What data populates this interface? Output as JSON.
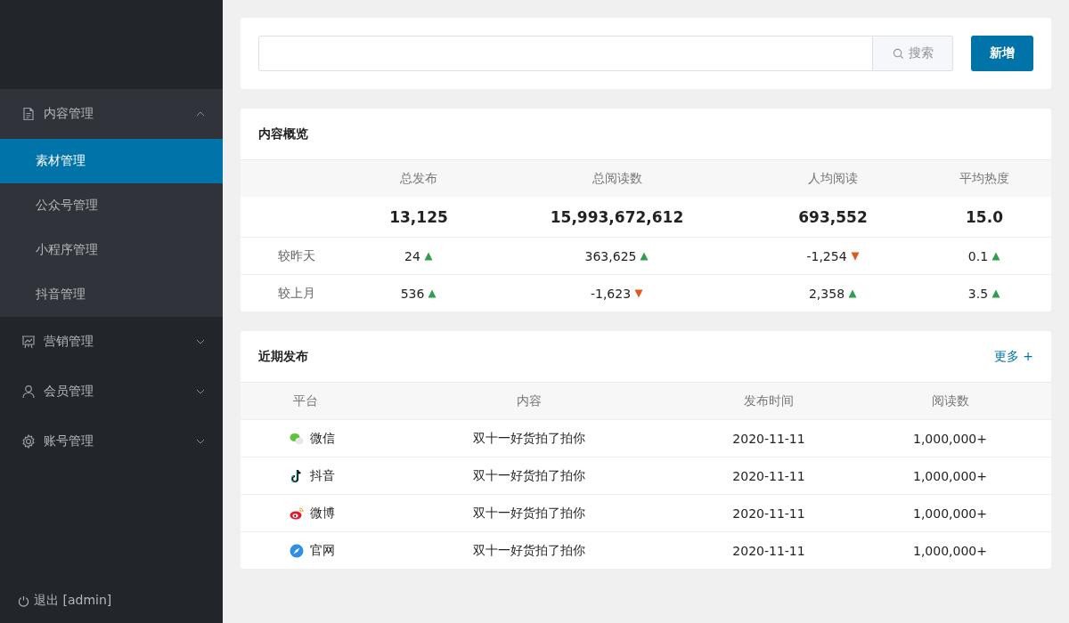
{
  "sidebar": {
    "menus": [
      {
        "kind": "document",
        "label": "内容管理",
        "expanded": true,
        "children": [
          {
            "label": "素材管理",
            "selected": true
          },
          {
            "label": "公众号管理",
            "selected": false
          },
          {
            "label": "小程序管理",
            "selected": false
          },
          {
            "label": "抖音管理",
            "selected": false
          }
        ]
      },
      {
        "kind": "chart",
        "label": "营销管理",
        "expanded": false
      },
      {
        "kind": "user",
        "label": "会员管理",
        "expanded": false
      },
      {
        "kind": "gear",
        "label": "账号管理",
        "expanded": false
      }
    ],
    "logout": "退出 [admin]"
  },
  "search": {
    "button": "搜索"
  },
  "add_button": "新增",
  "overview": {
    "title": "内容概览",
    "columns": [
      "总发布",
      "总阅读数",
      "人均阅读",
      "平均热度"
    ],
    "totals": [
      "13,125",
      "15,993,672,612",
      "693,552",
      "15.0"
    ],
    "rows": [
      {
        "label": "较昨天",
        "cells": [
          {
            "value": "24",
            "kind": "up"
          },
          {
            "value": "363,625",
            "kind": "up"
          },
          {
            "value": "-1,254",
            "kind": "down"
          },
          {
            "value": "0.1",
            "kind": "up"
          }
        ]
      },
      {
        "label": "较上月",
        "cells": [
          {
            "value": "536",
            "kind": "up"
          },
          {
            "value": "-1,623",
            "kind": "down"
          },
          {
            "value": "2,358",
            "kind": "up"
          },
          {
            "value": "3.5",
            "kind": "up"
          }
        ]
      }
    ]
  },
  "recent": {
    "title": "近期发布",
    "more": "更多 +",
    "columns": [
      "平台",
      "内容",
      "发布时间",
      "阅读数"
    ],
    "rows": [
      {
        "platform": "微信",
        "kind": "wechat",
        "content": "双十一好货拍了拍你",
        "time": "2020-11-11",
        "reads": "1,000,000+"
      },
      {
        "platform": "抖音",
        "kind": "douyin",
        "content": "双十一好货拍了拍你",
        "time": "2020-11-11",
        "reads": "1,000,000+"
      },
      {
        "platform": "微博",
        "kind": "weibo",
        "content": "双十一好货拍了拍你",
        "time": "2020-11-11",
        "reads": "1,000,000+"
      },
      {
        "platform": "官网",
        "kind": "web",
        "content": "双十一好货拍了拍你",
        "time": "2020-11-11",
        "reads": "1,000,000+"
      }
    ]
  }
}
